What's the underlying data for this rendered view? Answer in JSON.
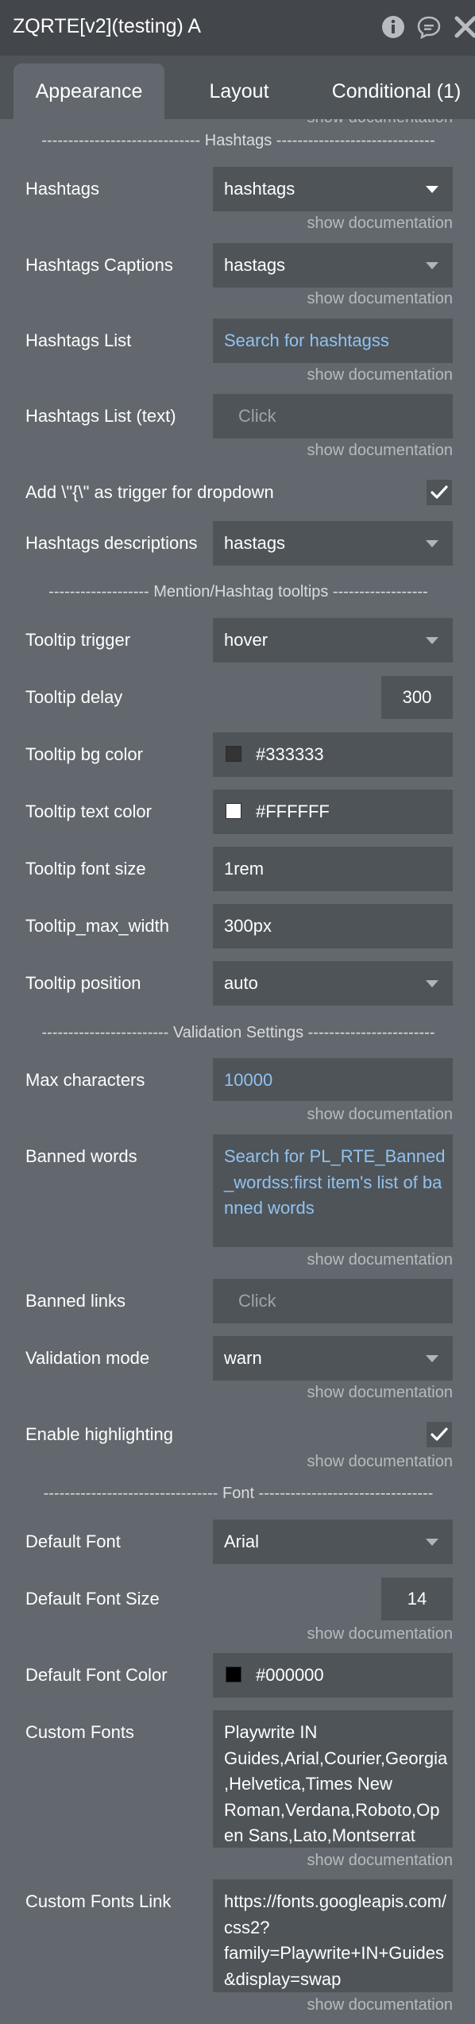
{
  "window": {
    "title": "ZQRTE[v2](testing) A",
    "icons": [
      "info-icon",
      "chat-bubble-icon",
      "close-icon"
    ]
  },
  "tabs": [
    {
      "label": "Appearance",
      "active": true
    },
    {
      "label": "Layout",
      "active": false
    },
    {
      "label": "Conditional (1)",
      "active": false
    }
  ],
  "doc_link": "show documentation",
  "sections": {
    "hashtags": "------------------------------ Hashtags ------------------------------",
    "tooltips": "------------------- Mention/Hashtag tooltips ------------------",
    "validation": "------------------------ Validation Settings ------------------------",
    "font": "--------------------------------- Font ---------------------------------"
  },
  "fields": {
    "hashtags": {
      "label": "Hashtags",
      "value": "hashtags"
    },
    "hashtags_captions": {
      "label": "Hashtags Captions",
      "value": "hastags"
    },
    "hashtags_list": {
      "label": "Hashtags List",
      "value": "Search for hashtagss"
    },
    "hashtags_list_text": {
      "label": "Hashtags List (text)",
      "placeholder": "Click"
    },
    "trigger": {
      "label": "Add \\\"{\\\" as trigger for dropdown",
      "checked": true
    },
    "hashtags_descriptions": {
      "label": "Hashtags descriptions",
      "value": "hastags"
    },
    "tooltip_trigger": {
      "label": "Tooltip trigger",
      "value": "hover"
    },
    "tooltip_delay": {
      "label": "Tooltip delay",
      "value": "300"
    },
    "tooltip_bg_color": {
      "label": "Tooltip bg color",
      "value": "#333333",
      "swatch": "#333333"
    },
    "tooltip_text_color": {
      "label": "Tooltip text color",
      "value": "#FFFFFF",
      "swatch": "#FFFFFF"
    },
    "tooltip_font_size": {
      "label": "Tooltip font size",
      "value": "1rem"
    },
    "tooltip_max_width": {
      "label": "Tooltip_max_width",
      "value": "300px"
    },
    "tooltip_position": {
      "label": "Tooltip position",
      "value": "auto"
    },
    "max_characters": {
      "label": "Max characters",
      "value": "10000"
    },
    "banned_words": {
      "label": "Banned words",
      "value": "Search for PL_RTE_Banned_wordss:first item's list of banned words"
    },
    "banned_links": {
      "label": "Banned links",
      "placeholder": "Click"
    },
    "validation_mode": {
      "label": "Validation mode",
      "value": "warn"
    },
    "enable_highlighting": {
      "label": "Enable highlighting",
      "checked": true
    },
    "default_font": {
      "label": "Default Font",
      "value": "Arial"
    },
    "default_font_size": {
      "label": "Default Font Size",
      "value": "14"
    },
    "default_font_color": {
      "label": "Default Font Color",
      "value": "#000000",
      "swatch": "#000000"
    },
    "custom_fonts": {
      "label": "Custom Fonts",
      "value": "Playwrite IN Guides,Arial,Courier,Georgia,Helvetica,Times New Roman,Verdana,Roboto,Open Sans,Lato,Montserrat"
    },
    "custom_fonts_link": {
      "label": "Custom Fonts Link",
      "value": "https://fonts.googleapis.com/css2?family=Playwrite+IN+Guides&display=swap"
    }
  },
  "colors": {
    "panel": "#62686d",
    "titlebar": "#43474b",
    "field": "#4f5458",
    "link_blue": "#90c2f0",
    "muted": "#b6bbbf"
  }
}
